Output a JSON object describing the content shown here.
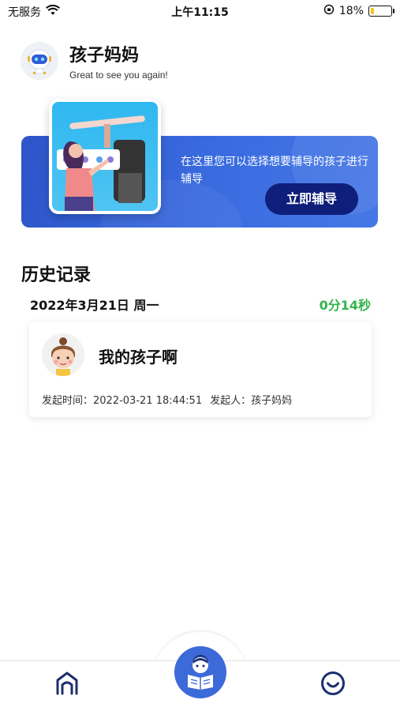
{
  "status_bar": {
    "carrier": "无服务",
    "time": "上午11:15",
    "battery_percent": "18%",
    "battery_level": 0.18
  },
  "header": {
    "name": "孩子妈妈",
    "greeting": "Great to see you again!"
  },
  "banner": {
    "description": "在这里您可以选择想要辅导的孩子进行辅导",
    "button_label": "立即辅导"
  },
  "history": {
    "section_title": "历史记录",
    "date": "2022年3月21日  周一",
    "duration": "0分14秒",
    "records": [
      {
        "name": "我的孩子啊",
        "time_label": "发起时间：",
        "time_value": "2022-03-21 18:44:51",
        "initiator_label": "发起人：",
        "initiator_value": "孩子妈妈"
      }
    ]
  },
  "tabbar": {
    "items": [
      {
        "icon": "home-icon"
      },
      {
        "icon": "reading-child-icon"
      },
      {
        "icon": "smile-profile-icon"
      }
    ]
  },
  "colors": {
    "accent": "#3d6ad9",
    "banner_button": "#0f1e7a",
    "duration_green": "#33b34d"
  }
}
